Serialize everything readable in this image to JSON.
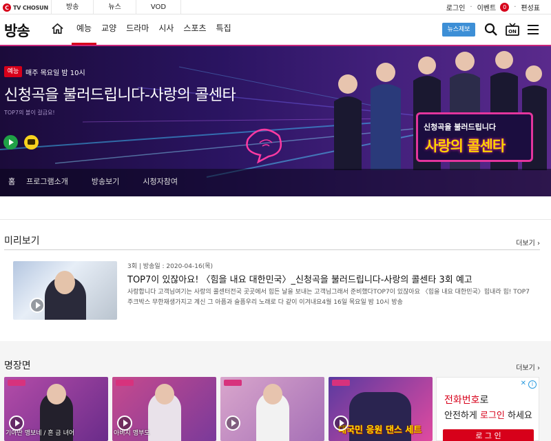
{
  "topbar": {
    "logo_text": "TV CHOSUN",
    "logo_mark": "C",
    "nav": [
      "방송",
      "뉴스",
      "VOD"
    ],
    "login": "로그인",
    "event": "이벤트",
    "event_count": "0",
    "schedule": "편성표"
  },
  "header": {
    "site_title": "방송",
    "nav": [
      "예능",
      "교양",
      "드라마",
      "시사",
      "스포츠",
      "특집"
    ],
    "active_nav": "예능",
    "news_tip_button": "뉴스제보"
  },
  "hero": {
    "genre_badge": "예능",
    "schedule": "매주 목요일 밤 10시",
    "title": "신청곡을 불러드립니다-사랑의 콜센타",
    "subtitle": "TOP7의 볼이 걸금요!",
    "logo_card_top": "신청곡을 불러드립니다",
    "logo_card_main": "사랑의 콜센타",
    "subnav": [
      "홈",
      "프로그램소개",
      "방송보기",
      "시청자참여"
    ],
    "active_subnav": "홈",
    "colors": {
      "accent": "#d7001a",
      "frame": "#e3359d",
      "logo_yellow": "#ffd400"
    }
  },
  "preview": {
    "heading": "미리보기",
    "more": "더보기",
    "episode": "3회",
    "airdate": "방송일 : 2020-04-16(목)",
    "title": "TOP7이 있잖아요! 〈힘을 내요 대한민국〉_신청곡을 불러드립니다-사랑의 콜센타 3회 예고",
    "description": "사랑합니다 고객님여기는 사랑의 콜센터전국 곳곳에서 힘든 날을 보내는 고객님그래서 준비했다TOP7이 있잖아요 〈힘을 내요 대한민국〉힘내라 힘! TOP7 주크박스 무한재생가지고 계신 그 아픔과 슬픔우리 노래로 다 같이 이겨내요4월 16일 목요일 밤 10시 방송"
  },
  "scenes": {
    "heading": "명장면",
    "more": "더보기",
    "items": [
      {
        "caption": "기아딴 맹보네 / 흔 금 녀어"
      },
      {
        "caption": "아버지 맹부도"
      },
      {
        "caption": ""
      },
      {
        "caption": "대국민 응원 댄스 세트"
      }
    ]
  },
  "ad": {
    "line1_highlight": "전화번호",
    "line1_rest": "로",
    "line2_pre": "안전하게 ",
    "line2_highlight": "로그인",
    "line2_rest": " 하세요",
    "button": "로 그 인"
  }
}
